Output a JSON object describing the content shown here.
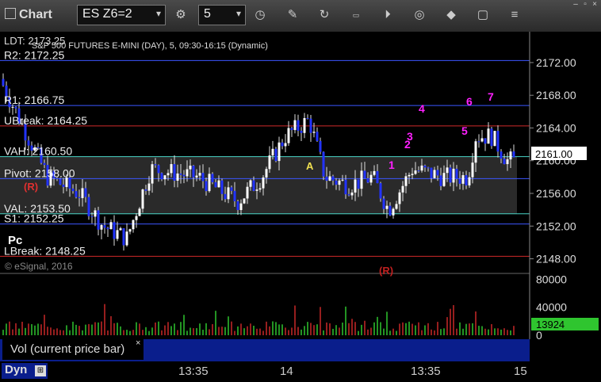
{
  "toolbar": {
    "title": "Chart",
    "symbol": "ES Z6=2",
    "interval": "5",
    "icons": [
      "settings-icon",
      "clock-icon",
      "pencil-icon",
      "refresh-icon",
      "get-icon",
      "play-icon",
      "compass-icon",
      "diamond-icon",
      "comment-icon",
      "bars-icon"
    ]
  },
  "chart_data": {
    "type": "candlestick",
    "title": "S&P 500 FUTURES E-MINI (DAY), 5, 09:30-16:15 (Dynamic)",
    "title_overlay": "LDT: 2173.25",
    "copyright": "© eSignal, 2016",
    "ylim": [
      2146.5,
      2175.0
    ],
    "yticks": [
      "2172.00",
      "2168.00",
      "2164.00",
      "2160.00",
      "2156.00",
      "2152.00",
      "2148.00"
    ],
    "last_price": "2161.00",
    "xticks": [
      "13:35",
      "14",
      "13:35",
      "15"
    ],
    "levels": [
      {
        "label": "R2: 2172.25",
        "value": 2172.25,
        "color": "#3b56ff"
      },
      {
        "label": "R1: 2166.75",
        "value": 2166.75,
        "color": "#3b56ff"
      },
      {
        "label": "UBreak: 2164.25",
        "value": 2164.25,
        "color": "#d02a2a"
      },
      {
        "label": "VAH: 2160.50",
        "value": 2160.5,
        "color": "#49d6c8"
      },
      {
        "label": "Pivot: 2158.00",
        "value": 2157.8,
        "color": "#3b56ff"
      },
      {
        "label": "VAL: 2153.50",
        "value": 2153.5,
        "color": "#49d6c8"
      },
      {
        "label": "S1: 2152.25",
        "value": 2152.25,
        "color": "#3b56ff"
      },
      {
        "label": "LBreak: 2148.25",
        "value": 2148.3,
        "color": "#d02a2a"
      }
    ],
    "value_area": [
      2153.5,
      2160.5
    ],
    "markers": [
      "(R)",
      "Pc",
      "A",
      "1",
      "2",
      "3",
      "4",
      "5",
      "6",
      "7",
      "(R)"
    ],
    "volume": {
      "label": "Vol (current price bar)",
      "last": "13924",
      "yticks": [
        "80000",
        "40000",
        "0"
      ],
      "ylim": [
        0,
        85000
      ]
    }
  }
}
